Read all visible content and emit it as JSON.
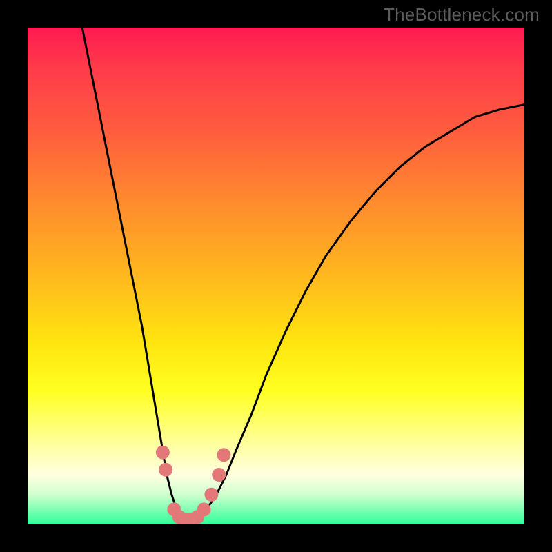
{
  "watermark": "TheBottleneck.com",
  "chart_data": {
    "type": "line",
    "title": "",
    "xlabel": "",
    "ylabel": "",
    "xlim": [
      0,
      100
    ],
    "ylim": [
      0,
      100
    ],
    "series": [
      {
        "name": "curve",
        "x": [
          11,
          13,
          15,
          17,
          19,
          21,
          23,
          24,
          25,
          26,
          27,
          28,
          29,
          30,
          31,
          32,
          33,
          34,
          36,
          38,
          40,
          42,
          45,
          48,
          52,
          56,
          60,
          65,
          70,
          75,
          80,
          85,
          90,
          95,
          100
        ],
        "y": [
          100,
          90,
          80,
          70,
          60,
          50,
          40,
          34,
          28,
          22,
          16,
          10,
          6,
          3,
          1,
          0,
          0,
          1,
          3,
          6,
          10,
          15,
          22,
          30,
          39,
          47,
          54,
          61,
          67,
          72,
          76,
          79,
          82,
          83.5,
          84.5
        ]
      }
    ],
    "markers": [
      {
        "x": 27.2,
        "y": 14.5
      },
      {
        "x": 27.8,
        "y": 11
      },
      {
        "x": 29.5,
        "y": 3
      },
      {
        "x": 30.5,
        "y": 1.5
      },
      {
        "x": 31.5,
        "y": 1
      },
      {
        "x": 33,
        "y": 1
      },
      {
        "x": 34.2,
        "y": 1.5
      },
      {
        "x": 35.5,
        "y": 3
      },
      {
        "x": 37,
        "y": 6
      },
      {
        "x": 38.5,
        "y": 10
      },
      {
        "x": 39.5,
        "y": 14
      }
    ],
    "colors": {
      "gradient_top": "#ff1a52",
      "gradient_mid": "#ffe40f",
      "gradient_bottom": "#2fff9a",
      "curve": "#000000",
      "markers": "#e27878"
    }
  }
}
